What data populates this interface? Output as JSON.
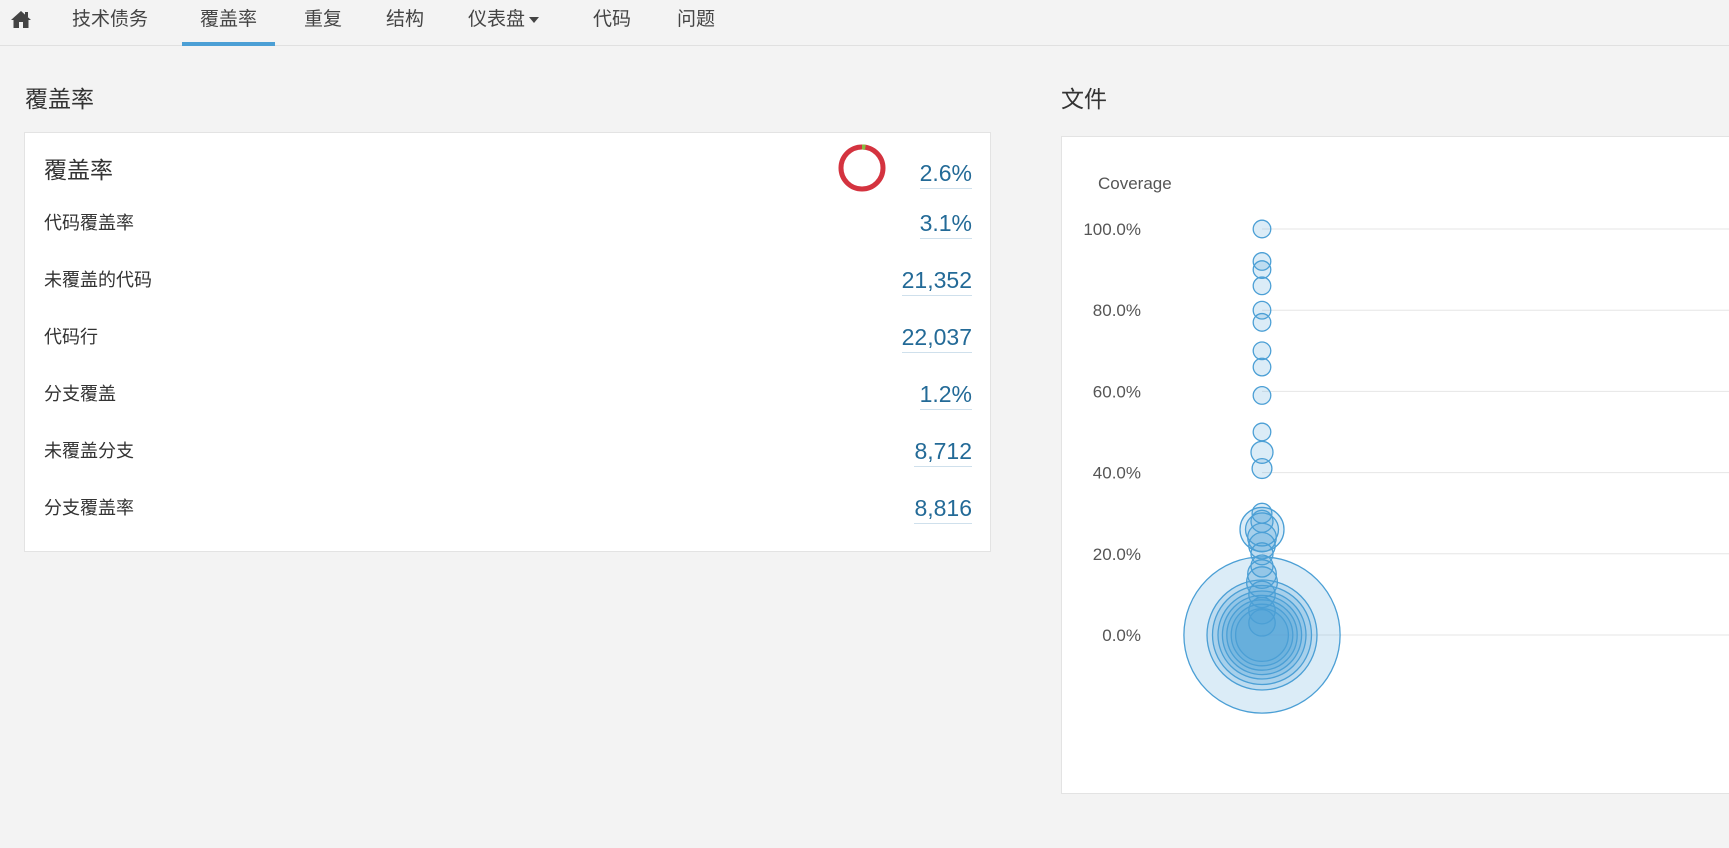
{
  "nav": {
    "home_icon": "home-icon",
    "items": [
      {
        "label": "技术债务"
      },
      {
        "label": "覆盖率",
        "active": true
      },
      {
        "label": "重复"
      },
      {
        "label": "结构"
      },
      {
        "label": "仪表盘",
        "dropdown": true
      },
      {
        "label": "代码"
      },
      {
        "label": "问题"
      }
    ]
  },
  "left": {
    "heading": "覆盖率",
    "rows": [
      {
        "label": "覆盖率",
        "value": "2.6%"
      },
      {
        "label": "代码覆盖率",
        "value": "3.1%"
      },
      {
        "label": "未覆盖的代码",
        "value": "21,352"
      },
      {
        "label": "代码行",
        "value": "22,037"
      },
      {
        "label": "分支覆盖",
        "value": "1.2%"
      },
      {
        "label": "未覆盖分支",
        "value": "8,712"
      },
      {
        "label": "分支覆盖率",
        "value": "8,816"
      }
    ],
    "donut": {
      "percent": 2.6,
      "color_fill": "#85bb43",
      "color_empty": "#d4333f"
    }
  },
  "right": {
    "heading": "文件",
    "chart_data": {
      "type": "scatter",
      "ylabel": "Coverage",
      "ylim": [
        0,
        100
      ],
      "yticks": [
        "0.0%",
        "20.0%",
        "40.0%",
        "60.0%",
        "80.0%",
        "100.0%"
      ],
      "grid": true,
      "color": "#4b9fd5",
      "points": [
        {
          "y": 0,
          "size": 71
        },
        {
          "y": 0,
          "size": 50
        },
        {
          "y": 0,
          "size": 45
        },
        {
          "y": 0,
          "size": 40
        },
        {
          "y": 0,
          "size": 36
        },
        {
          "y": 0,
          "size": 32
        },
        {
          "y": 0,
          "size": 28
        },
        {
          "y": 0,
          "size": 24
        },
        {
          "y": 3,
          "size": 12
        },
        {
          "y": 6,
          "size": 12
        },
        {
          "y": 10,
          "size": 12
        },
        {
          "y": 13,
          "size": 14
        },
        {
          "y": 15,
          "size": 13
        },
        {
          "y": 17,
          "size": 10
        },
        {
          "y": 20,
          "size": 10
        },
        {
          "y": 22,
          "size": 12
        },
        {
          "y": 24,
          "size": 13
        },
        {
          "y": 26,
          "size": 20
        },
        {
          "y": 26,
          "size": 15
        },
        {
          "y": 28,
          "size": 10
        },
        {
          "y": 30,
          "size": 9
        },
        {
          "y": 41,
          "size": 9
        },
        {
          "y": 45,
          "size": 10
        },
        {
          "y": 50,
          "size": 8
        },
        {
          "y": 59,
          "size": 8
        },
        {
          "y": 66,
          "size": 8
        },
        {
          "y": 70,
          "size": 8
        },
        {
          "y": 77,
          "size": 8
        },
        {
          "y": 80,
          "size": 8
        },
        {
          "y": 86,
          "size": 8
        },
        {
          "y": 90,
          "size": 8
        },
        {
          "y": 92,
          "size": 8
        },
        {
          "y": 100,
          "size": 8
        }
      ]
    }
  }
}
